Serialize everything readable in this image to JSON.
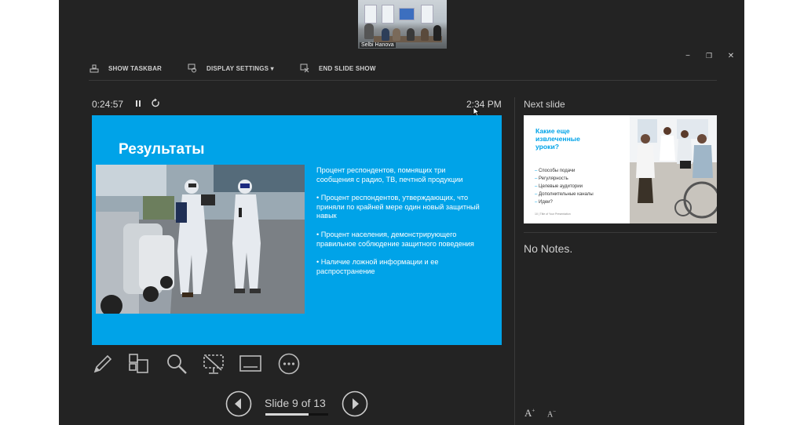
{
  "webcam": {
    "participant_name": "Selbi Hanova"
  },
  "toolbar": {
    "show_taskbar": "SHOW TASKBAR",
    "display_settings": "DISPLAY SETTINGS ▾",
    "end_slide_show": "END SLIDE SHOW"
  },
  "window_controls": {
    "minimize": "−",
    "restore": "❐",
    "close": "✕"
  },
  "presenter": {
    "timer": "0:24:57",
    "clock": "2:34 PM"
  },
  "slide": {
    "title": "Результаты",
    "bullets": [
      "Процент респондентов, помнящих три сообщения с радио, ТВ, печтной продукции",
      "• Процент респондентов, утверждающих, что приняли по крайней мере один новый защитный навык",
      "• Процент населения, демонстрирующего правильное соблюдение защитного поведения",
      "• Наличие ложной информации и ее распространение"
    ]
  },
  "navigation": {
    "slide_indicator": "Slide 9 of 13",
    "progress": 0.69
  },
  "next_slide": {
    "label": "Next slide",
    "title": "Какие еще извлеченные уроки?",
    "items": [
      "Способы подачи",
      "Регулярность",
      "Целевые аудитории",
      "Дополнительные каналы",
      "Идеи?"
    ],
    "footer": "10  |  Title of Your Presentation"
  },
  "notes": {
    "text": "No Notes."
  },
  "font_controls": {
    "increase": "A",
    "decrease": "A"
  },
  "colors": {
    "slide_bg": "#00a3e8",
    "app_bg": "#232323",
    "accent": "#00a3e8"
  },
  "icons": {
    "tools": [
      "pen-icon",
      "see-all-slides-icon",
      "zoom-icon",
      "black-screen-icon",
      "subtitles-icon",
      "more-options-icon"
    ]
  }
}
